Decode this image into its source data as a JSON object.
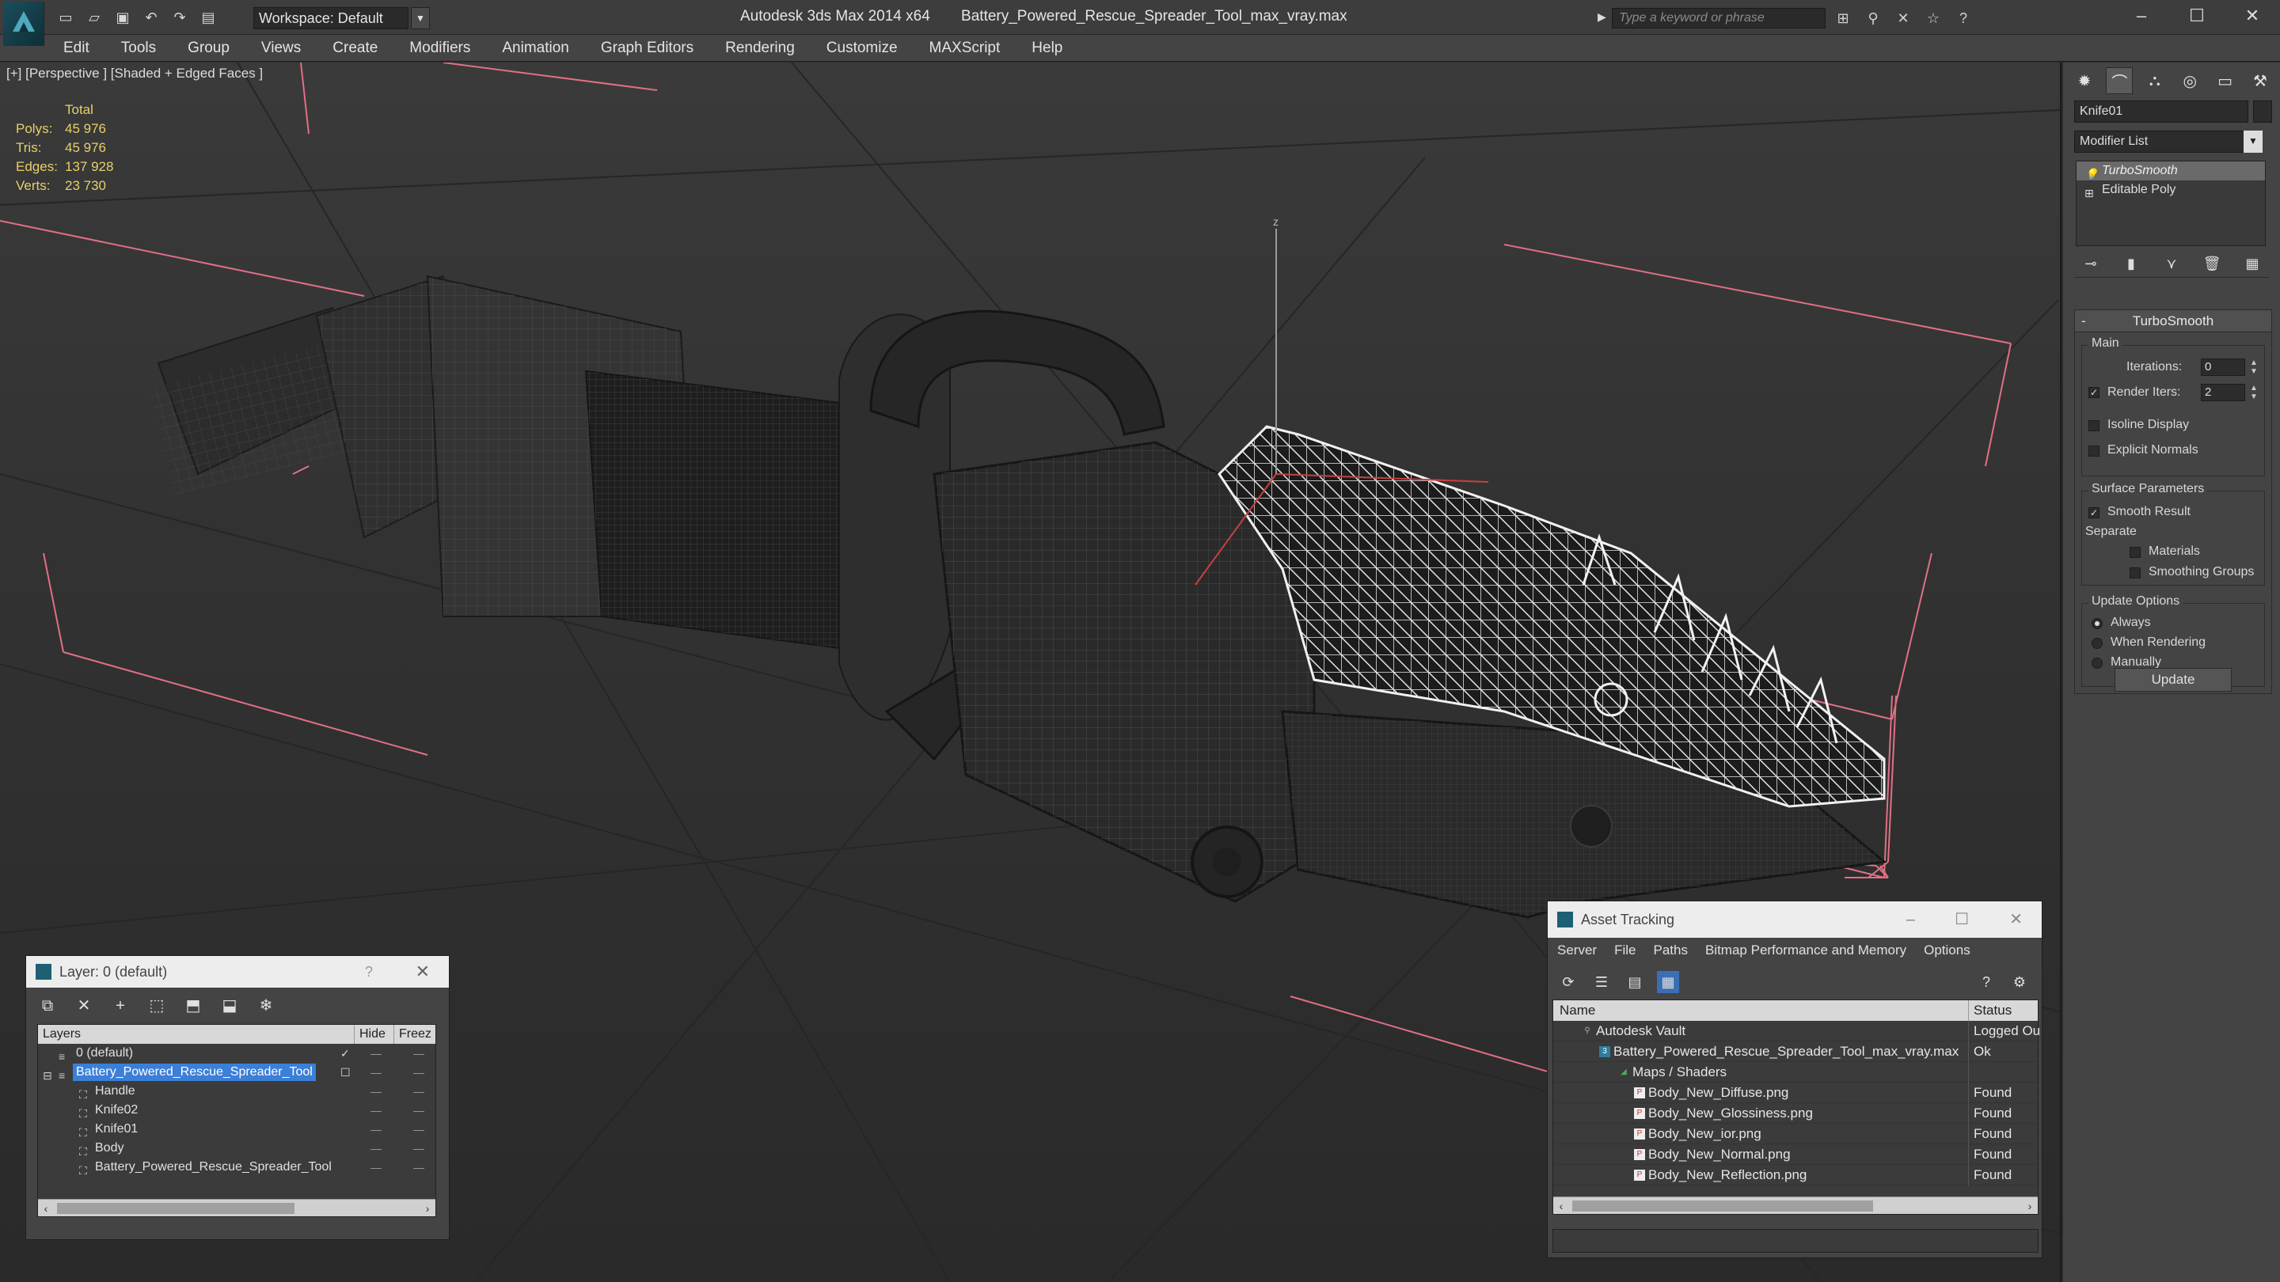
{
  "titlebar": {
    "app_name": "Autodesk 3ds Max  2014 x64",
    "file_name": "Battery_Powered_Rescue_Spreader_Tool_max_vray.max",
    "workspace_label": "Workspace: Default",
    "search_placeholder": "Type a keyword or phrase"
  },
  "menu": [
    "Edit",
    "Tools",
    "Group",
    "Views",
    "Create",
    "Modifiers",
    "Animation",
    "Graph Editors",
    "Rendering",
    "Customize",
    "MAXScript",
    "Help"
  ],
  "viewport": {
    "label": "[+] [Perspective ] [Shaded + Edged Faces ]",
    "stats": {
      "header": "Total",
      "rows": [
        {
          "key": "Polys:",
          "value": "45 976"
        },
        {
          "key": "Tris:",
          "value": "45 976"
        },
        {
          "key": "Edges:",
          "value": "137 928"
        },
        {
          "key": "Verts:",
          "value": "23 730"
        }
      ]
    },
    "gizmo_axis": "z"
  },
  "command_panel": {
    "object_name": "Knife01",
    "modifier_list": "Modifier List",
    "stack": [
      "TurboSmooth",
      "Editable Poly"
    ],
    "turbosmooth": {
      "title": "TurboSmooth",
      "main_label": "Main",
      "iterations_label": "Iterations:",
      "iterations_value": "0",
      "render_iters_label": "Render Iters:",
      "render_iters_value": "2",
      "isoline_label": "Isoline Display",
      "explicit_normals_label": "Explicit Normals",
      "surface_params_label": "Surface Parameters",
      "smooth_result_label": "Smooth Result",
      "separate_label": "Separate",
      "materials_label": "Materials",
      "smoothing_groups_label": "Smoothing Groups",
      "update_options_label": "Update Options",
      "always_label": "Always",
      "when_rendering_label": "When Rendering",
      "manually_label": "Manually",
      "update_button": "Update"
    }
  },
  "layer_dialog": {
    "title": "Layer: 0 (default)",
    "help": "?",
    "columns": [
      "Layers",
      "Hide",
      "Freez"
    ],
    "rows": [
      {
        "name": "0 (default)"
      },
      {
        "name": "Battery_Powered_Rescue_Spreader_Tool"
      },
      {
        "name": "Handle"
      },
      {
        "name": "Knife02"
      },
      {
        "name": "Knife01"
      },
      {
        "name": "Body"
      },
      {
        "name": "Battery_Powered_Rescue_Spreader_Tool"
      }
    ]
  },
  "asset_dialog": {
    "title": "Asset Tracking",
    "menu": [
      "Server",
      "File",
      "Paths",
      "Bitmap Performance and Memory",
      "Options"
    ],
    "columns": [
      "Name",
      "Status"
    ],
    "rows": [
      {
        "name": "Autodesk Vault",
        "status": "Logged Ou"
      },
      {
        "name": "Battery_Powered_Rescue_Spreader_Tool_max_vray.max",
        "status": "Ok"
      },
      {
        "name": "Maps / Shaders",
        "status": ""
      },
      {
        "name": "Body_New_Diffuse.png",
        "status": "Found"
      },
      {
        "name": "Body_New_Glossiness.png",
        "status": "Found"
      },
      {
        "name": "Body_New_ior.png",
        "status": "Found"
      },
      {
        "name": "Body_New_Normal.png",
        "status": "Found"
      },
      {
        "name": "Body_New_Reflection.png",
        "status": "Found"
      }
    ]
  }
}
